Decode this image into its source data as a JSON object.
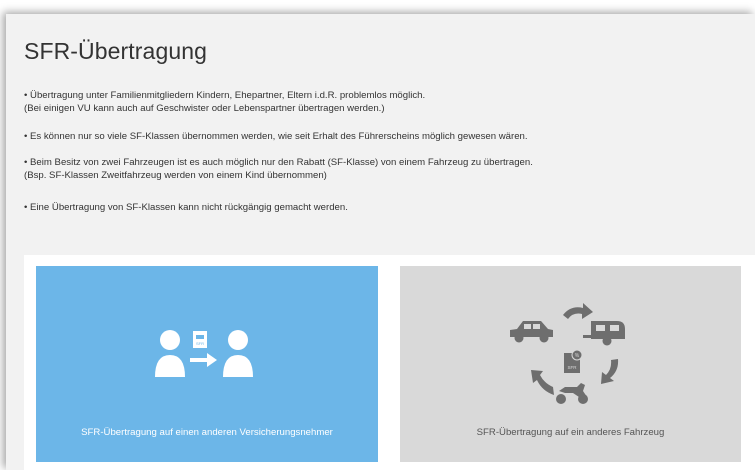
{
  "page": {
    "title": "SFR-Übertragung"
  },
  "info": {
    "bullet1_line1": "• Übertragung unter Familienmitgliedern Kindern, Ehepartner, Eltern i.d.R. problemlos möglich.",
    "bullet1_line2": "(Bei einigen VU kann auch auf Geschwister oder Lebenspartner übertragen werden.)",
    "bullet2": "• Es können nur so viele SF-Klassen übernommen werden, wie seit Erhalt des Führerscheins möglich gewesen wären.",
    "bullet3_line1": "• Beim Besitz von zwei Fahrzeugen ist es auch möglich nur den Rabatt (SF-Klasse) von einem Fahrzeug zu übertragen.",
    "bullet3_line2": "(Bsp. SF-Klassen Zweitfahrzeug werden von einem Kind übernommen)",
    "bullet4": "• Eine Übertragung von SF-Klassen kann nicht rückgängig gemacht werden."
  },
  "cards": {
    "person": {
      "label": "SFR-Übertragung auf einen anderen Versicherungsnehmer",
      "icon_badge": "SFR",
      "background": "#6cb6e8"
    },
    "vehicle": {
      "label": "SFR-Übertragung auf ein anderes Fahrzeug",
      "icon_badge": "SFR",
      "background": "#d9d9d9"
    }
  },
  "icons": {
    "person_card": [
      "person-icon",
      "sfr-document-icon",
      "arrow-right-icon",
      "person-icon"
    ],
    "vehicle_card": [
      "car-icon",
      "caravan-icon",
      "motorcycle-icon",
      "sfr-document-icon",
      "cycle-arrows-icon"
    ]
  }
}
